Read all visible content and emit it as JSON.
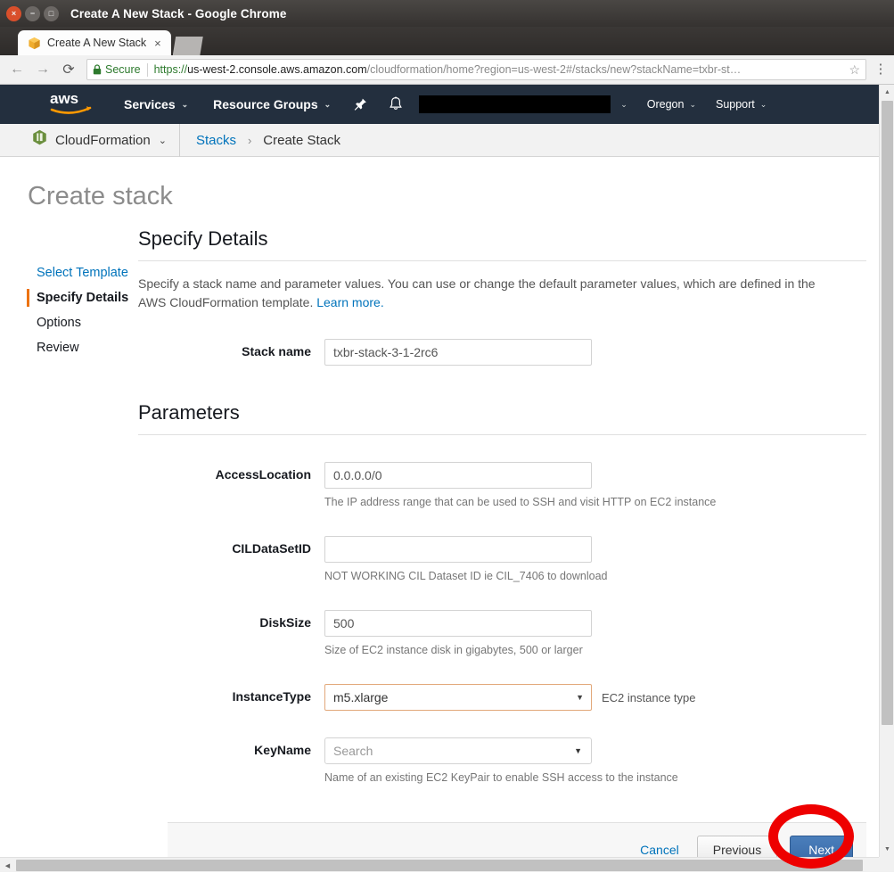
{
  "window": {
    "title": "Create A New Stack - Google Chrome",
    "controls": {
      "close": "×",
      "minimize": "−",
      "maximize": "□"
    }
  },
  "tab": {
    "title": "Create A New Stack",
    "close_label": "×",
    "favicon_name": "cloudformation-cube-icon"
  },
  "toolbar": {
    "back": "←",
    "forward": "→",
    "reload": "⟳",
    "secure_label": "Secure",
    "url_scheme": "https://",
    "url_host": "us-west-2.console.aws.amazon.com",
    "url_path": "/cloudformation/home?region=us-west-2#/stacks/new?stackName=txbr-st…",
    "bookmark": "☆",
    "menu": "⋮"
  },
  "aws_nav": {
    "logo_text": "aws",
    "services": "Services",
    "resource_groups": "Resource Groups",
    "pin_icon": "pin-icon",
    "bell_icon": "bell-icon",
    "account_redacted": "",
    "account_caret": "⌄",
    "region": "Oregon",
    "support": "Support",
    "caret": "⌄"
  },
  "breadcrumb": {
    "service": "CloudFormation",
    "service_caret": "⌄",
    "stacks": "Stacks",
    "separator": "›",
    "current": "Create Stack"
  },
  "page": {
    "title": "Create stack"
  },
  "side_nav": {
    "items": [
      {
        "label": "Select Template",
        "state": "link"
      },
      {
        "label": "Specify Details",
        "state": "current"
      },
      {
        "label": "Options",
        "state": "normal"
      },
      {
        "label": "Review",
        "state": "normal"
      }
    ]
  },
  "specify_details": {
    "heading": "Specify Details",
    "description_1": "Specify a stack name and parameter values. You can use or change the default parameter values, which are defined in the AWS CloudFormation template. ",
    "learn_more": "Learn more.",
    "stack_name_label": "Stack name",
    "stack_name_value": "txbr-stack-3-1-2rc6"
  },
  "parameters": {
    "heading": "Parameters",
    "items": [
      {
        "label": "AccessLocation",
        "type": "text",
        "value": "0.0.0.0/0",
        "placeholder": "",
        "hint": "The IP address range that can be used to SSH and visit HTTP on EC2 instance",
        "inline_hint": ""
      },
      {
        "label": "CILDataSetID",
        "type": "text",
        "value": "",
        "placeholder": "",
        "hint": "NOT WORKING CIL Dataset ID ie CIL_7406 to download",
        "inline_hint": ""
      },
      {
        "label": "DiskSize",
        "type": "text",
        "value": "500",
        "placeholder": "",
        "hint": "Size of EC2 instance disk in gigabytes, 500 or larger",
        "inline_hint": ""
      },
      {
        "label": "InstanceType",
        "type": "select",
        "value": "m5.xlarge",
        "placeholder": "",
        "hint": "",
        "inline_hint": "EC2 instance type"
      },
      {
        "label": "KeyName",
        "type": "combo",
        "value": "",
        "placeholder": "Search",
        "hint": "Name of an existing EC2 KeyPair to enable SSH access to the instance",
        "inline_hint": ""
      }
    ]
  },
  "footer": {
    "cancel": "Cancel",
    "previous": "Previous",
    "next": "Next"
  },
  "annotation": {
    "shape": "ellipse",
    "color": "#ee0000",
    "target": "Next"
  },
  "scrollbars": {
    "up": "▲",
    "down": "▼",
    "left": "◀",
    "right": "▶"
  },
  "colors": {
    "aws_nav_bg": "#232f3e",
    "aws_orange": "#ec7211",
    "link_blue": "#0073bb",
    "annotation_red": "#ee0000",
    "focus_border": "#e2a87a"
  }
}
